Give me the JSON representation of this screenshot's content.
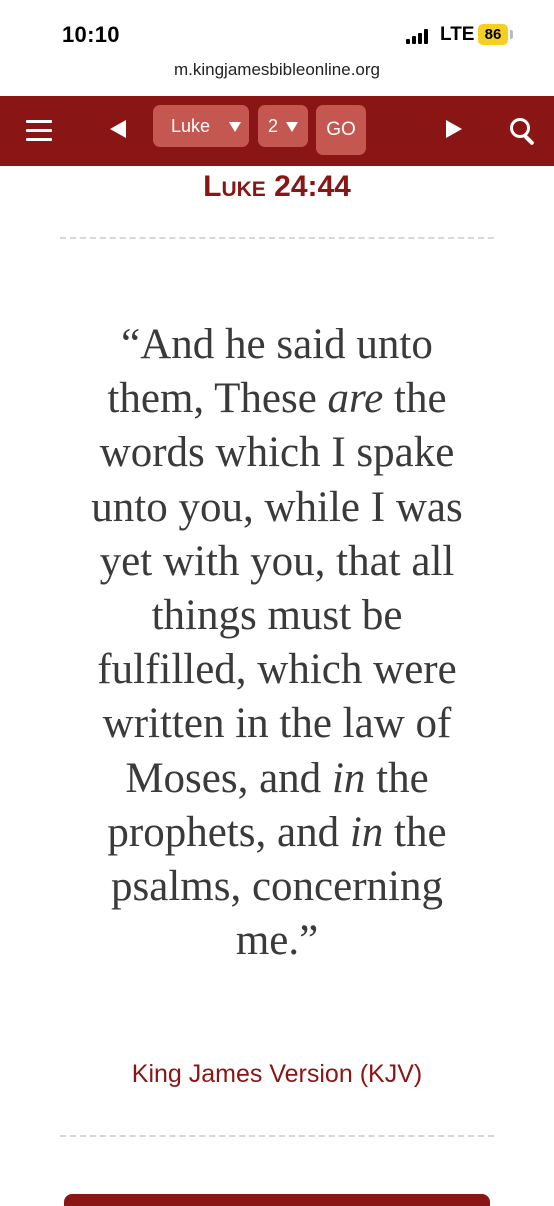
{
  "status_bar": {
    "time": "10:10",
    "network": "LTE",
    "battery": "86"
  },
  "browser": {
    "url": "m.kingjamesbibleonline.org"
  },
  "nav": {
    "book": "Luke",
    "chapter": "2",
    "go_label": "GO",
    "accent_color": "#8a1515",
    "button_color": "#c4574f"
  },
  "verse": {
    "book_ref": "Luke",
    "chapter_verse": "24:44",
    "segments": [
      {
        "text": "“And he said unto them, These ",
        "italic": false
      },
      {
        "text": "are",
        "italic": true
      },
      {
        "text": " the words which I spake unto you, while I was yet with you, that all things must be fulfilled, which were written in the law of Moses, and ",
        "italic": false
      },
      {
        "text": "in",
        "italic": true
      },
      {
        "text": " the prophets, and ",
        "italic": false
      },
      {
        "text": "in",
        "italic": true
      },
      {
        "text": " the psalms, concerning me.”",
        "italic": false
      }
    ],
    "version": "King James Version (KJV)"
  }
}
